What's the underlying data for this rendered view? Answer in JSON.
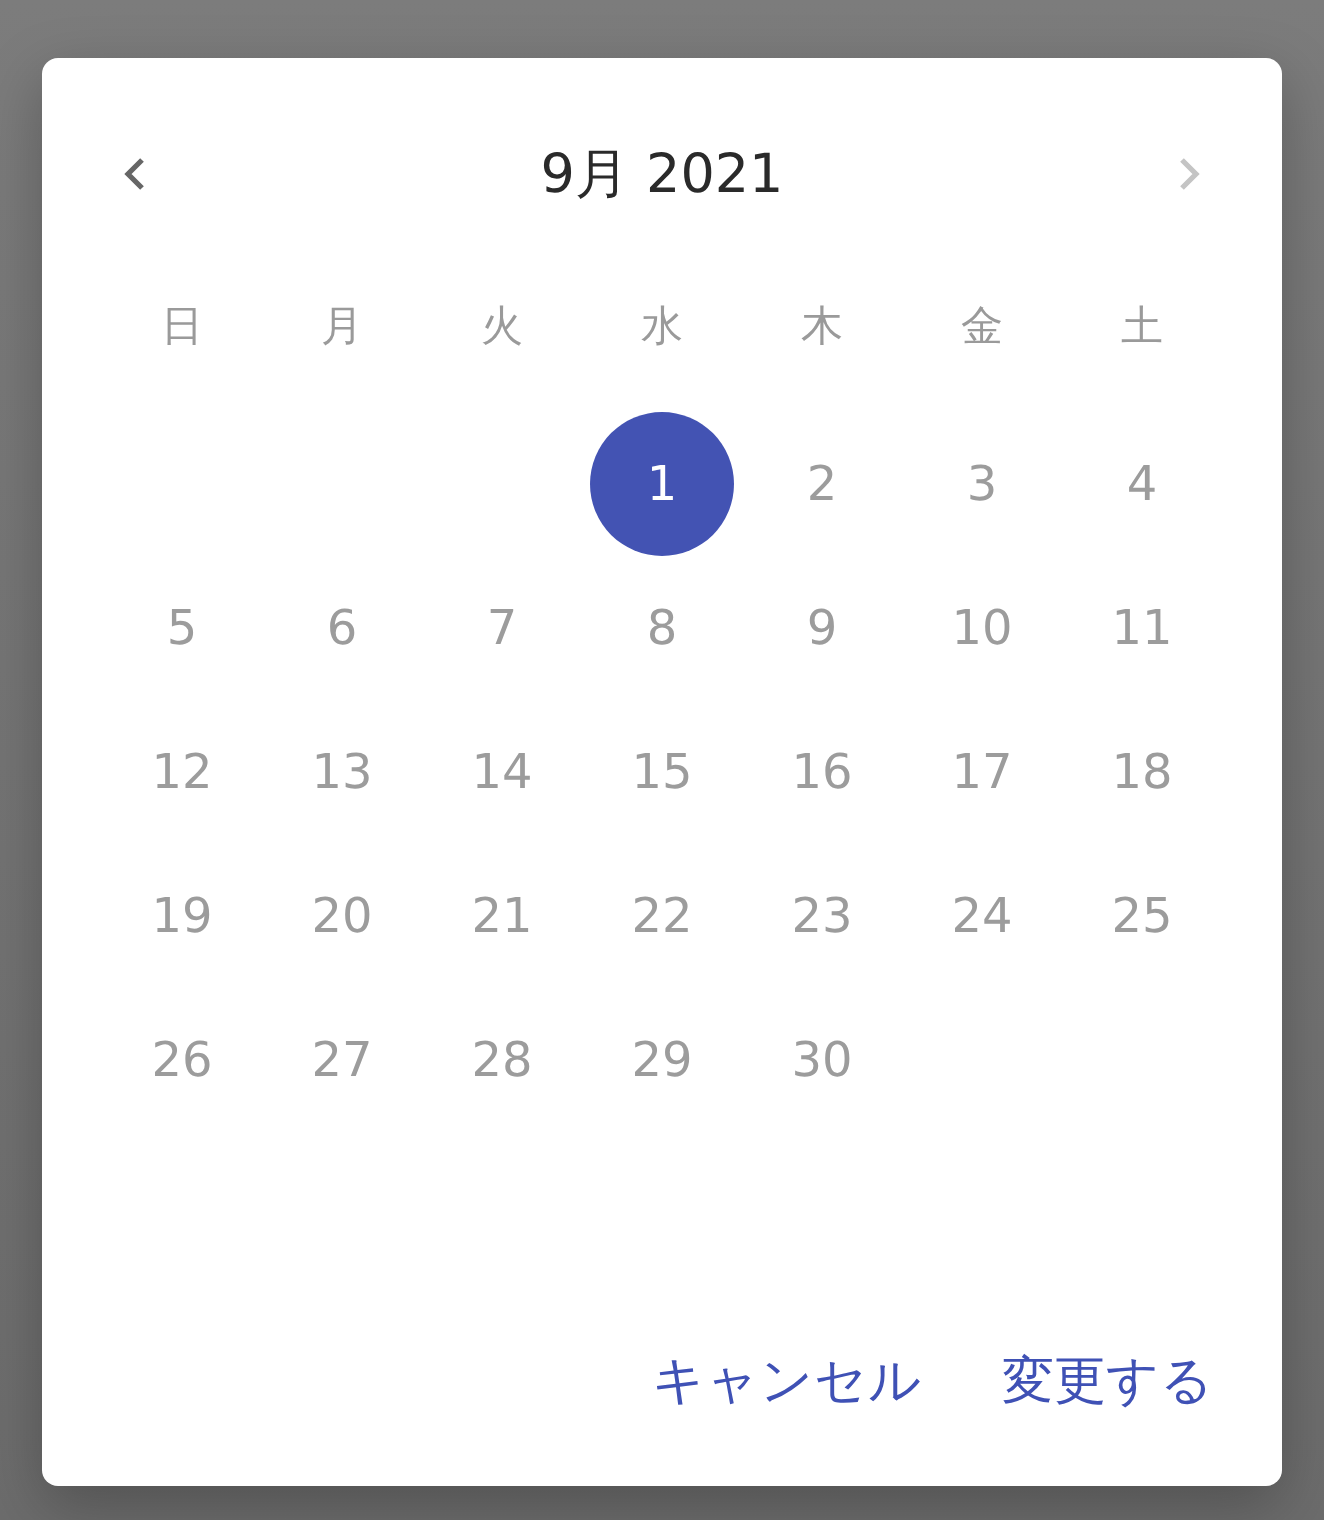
{
  "header": {
    "prev": {
      "disabled": false
    },
    "title": "9月 2021",
    "next": {
      "disabled": true
    }
  },
  "weekdays": [
    "日",
    "月",
    "火",
    "水",
    "木",
    "金",
    "土"
  ],
  "weeks": [
    [
      {
        "kind": "empty"
      },
      {
        "kind": "empty"
      },
      {
        "kind": "empty"
      },
      {
        "kind": "day",
        "label": "1",
        "selected": true
      },
      {
        "kind": "day",
        "label": "2",
        "selected": false
      },
      {
        "kind": "day",
        "label": "3",
        "selected": false
      },
      {
        "kind": "day",
        "label": "4",
        "selected": false
      }
    ],
    [
      {
        "kind": "day",
        "label": "5",
        "selected": false
      },
      {
        "kind": "day",
        "label": "6",
        "selected": false
      },
      {
        "kind": "day",
        "label": "7",
        "selected": false
      },
      {
        "kind": "day",
        "label": "8",
        "selected": false
      },
      {
        "kind": "day",
        "label": "9",
        "selected": false
      },
      {
        "kind": "day",
        "label": "10",
        "selected": false
      },
      {
        "kind": "day",
        "label": "11",
        "selected": false
      }
    ],
    [
      {
        "kind": "day",
        "label": "12",
        "selected": false
      },
      {
        "kind": "day",
        "label": "13",
        "selected": false
      },
      {
        "kind": "day",
        "label": "14",
        "selected": false
      },
      {
        "kind": "day",
        "label": "15",
        "selected": false
      },
      {
        "kind": "day",
        "label": "16",
        "selected": false
      },
      {
        "kind": "day",
        "label": "17",
        "selected": false
      },
      {
        "kind": "day",
        "label": "18",
        "selected": false
      }
    ],
    [
      {
        "kind": "day",
        "label": "19",
        "selected": false
      },
      {
        "kind": "day",
        "label": "20",
        "selected": false
      },
      {
        "kind": "day",
        "label": "21",
        "selected": false
      },
      {
        "kind": "day",
        "label": "22",
        "selected": false
      },
      {
        "kind": "day",
        "label": "23",
        "selected": false
      },
      {
        "kind": "day",
        "label": "24",
        "selected": false
      },
      {
        "kind": "day",
        "label": "25",
        "selected": false
      }
    ],
    [
      {
        "kind": "day",
        "label": "26",
        "selected": false
      },
      {
        "kind": "day",
        "label": "27",
        "selected": false
      },
      {
        "kind": "day",
        "label": "28",
        "selected": false
      },
      {
        "kind": "day",
        "label": "29",
        "selected": false
      },
      {
        "kind": "day",
        "label": "30",
        "selected": false
      }
    ]
  ],
  "buttons": [
    "キャンセル",
    "変更する"
  ]
}
